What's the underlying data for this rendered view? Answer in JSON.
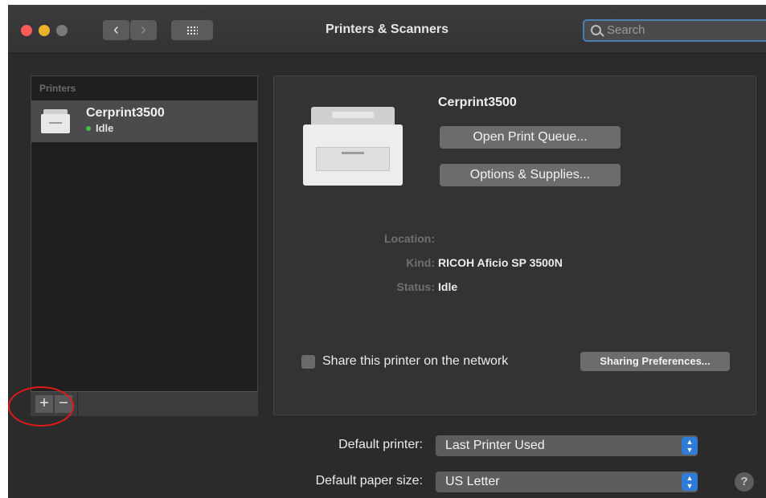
{
  "window": {
    "title": "Printers & Scanners"
  },
  "toolbar": {
    "back_icon": "chevron-left-icon",
    "forward_icon": "chevron-right-icon",
    "grid_icon": "grid-icon",
    "search_placeholder": "Search"
  },
  "sidebar": {
    "header": "Printers",
    "printers": [
      {
        "name": "Cerprint3500",
        "status": "Idle",
        "status_color": "#3fc14a"
      }
    ],
    "add_label": "+",
    "remove_label": "−"
  },
  "details": {
    "printer_name": "Cerprint3500",
    "open_queue_label": "Open Print Queue...",
    "options_label": "Options & Supplies...",
    "location_label": "Location:",
    "location_value": "",
    "kind_label": "Kind:",
    "kind_value": "RICOH Aficio SP 3500N",
    "status_label": "Status:",
    "status_value": "Idle",
    "share_label": "Share this printer on the network",
    "share_checked": false,
    "sharing_prefs_label": "Sharing Preferences..."
  },
  "defaults": {
    "printer_label": "Default printer:",
    "printer_value": "Last Printer Used",
    "paper_label": "Default paper size:",
    "paper_value": "US Letter"
  },
  "help_label": "?",
  "annotation_color": "#e01a1a"
}
